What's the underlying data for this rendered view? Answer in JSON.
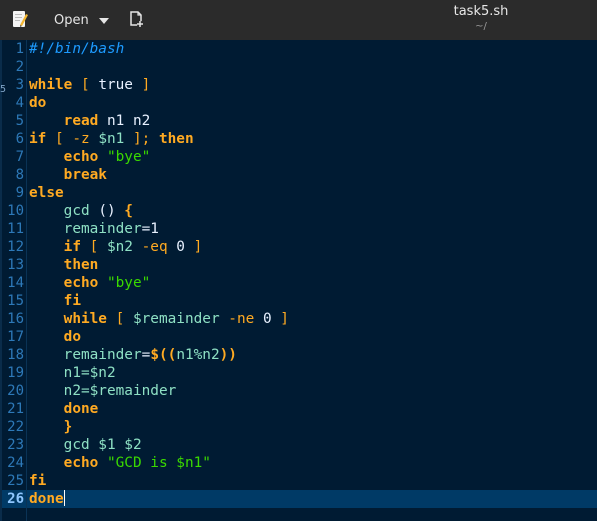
{
  "header": {
    "open_label": "Open",
    "title": "task5.sh",
    "subtitle": "~/"
  },
  "editor": {
    "current_line": 26,
    "left_margin_glyph": "5",
    "lines": [
      {
        "n": "1"
      },
      {
        "n": "2"
      },
      {
        "n": "3"
      },
      {
        "n": "4"
      },
      {
        "n": "5"
      },
      {
        "n": "6"
      },
      {
        "n": "7"
      },
      {
        "n": "8"
      },
      {
        "n": "9"
      },
      {
        "n": "10"
      },
      {
        "n": "11"
      },
      {
        "n": "12"
      },
      {
        "n": "13"
      },
      {
        "n": "14"
      },
      {
        "n": "15"
      },
      {
        "n": "16"
      },
      {
        "n": "17"
      },
      {
        "n": "18"
      },
      {
        "n": "19"
      },
      {
        "n": "20"
      },
      {
        "n": "21"
      },
      {
        "n": "22"
      },
      {
        "n": "23"
      },
      {
        "n": "24"
      },
      {
        "n": "25"
      },
      {
        "n": "26"
      }
    ],
    "code": {
      "l1_comment": "#!/bin/bash",
      "l3_kw": "while",
      "l3_b1": " [",
      "l3_word": " true",
      "l3_b2": " ]",
      "l4_kw": "do",
      "l5_indent": "    ",
      "l5_kw": "read",
      "l5_rest": " n1 n2",
      "l6_kw": "if",
      "l6_b1": " [",
      "l6_opt": " -z ",
      "l6_var": "$n1",
      "l6_b2": " ];",
      "l6_kw2": " then",
      "l7_indent": "    ",
      "l7_kw": "echo",
      "l7_str": " \"bye\"",
      "l8_indent": "    ",
      "l8_kw": "break",
      "l9_kw": "else",
      "l10_indent": "    ",
      "l10_name": "gcd ",
      "l10_paren": "()",
      "l10_brace": " {",
      "l11_indent": "    ",
      "l11_var": "remainder",
      "l11_rest": "=1",
      "l12_indent": "    ",
      "l12_kw": "if",
      "l12_b1": " [",
      "l12_var": " $n2",
      "l12_opt": " -eq",
      "l12_rest": " 0",
      "l12_b2": " ]",
      "l13_indent": "    ",
      "l13_kw": "then",
      "l14_indent": "    ",
      "l14_kw": "echo",
      "l14_str": " \"bye\"",
      "l15_indent": "    ",
      "l15_kw": "fi",
      "l16_indent": "    ",
      "l16_kw": "while",
      "l16_b1": " [",
      "l16_var": " $remainder",
      "l16_opt": " -ne",
      "l16_rest": " 0",
      "l16_b2": " ]",
      "l17_indent": "    ",
      "l17_kw": "do",
      "l18_indent": "    ",
      "l18_var": "remainder",
      "l18_eq": "=",
      "l18_sub": "$((",
      "l18_inner": "n1%n2",
      "l18_close": "))",
      "l19_indent": "    ",
      "l19_var": "n1",
      "l19_rest": "=$n2",
      "l20_indent": "    ",
      "l20_var": "n2",
      "l20_rest": "=$remainder",
      "l21_indent": "    ",
      "l21_kw": "done",
      "l22_indent": "    ",
      "l22_brace": "}",
      "l23_indent": "    ",
      "l23_rest": "gcd $1 $2",
      "l24_indent": "    ",
      "l24_kw": "echo",
      "l24_str": " \"GCD is $n1\"",
      "l25_kw": "fi",
      "l26_kw": "done"
    }
  },
  "colors": {
    "background": "#001b33",
    "header_bg": "#2b2b2b",
    "keyword": "#ffaa22",
    "string": "#3ad900",
    "variable": "#8ee0c4",
    "comment": "#1d9bff",
    "line_number": "#2d79b8",
    "current_line": "#003a66"
  },
  "icons": {
    "app": "text-editor-icon",
    "open_chevron": "chevron-down-icon",
    "new_document": "new-document-icon"
  }
}
